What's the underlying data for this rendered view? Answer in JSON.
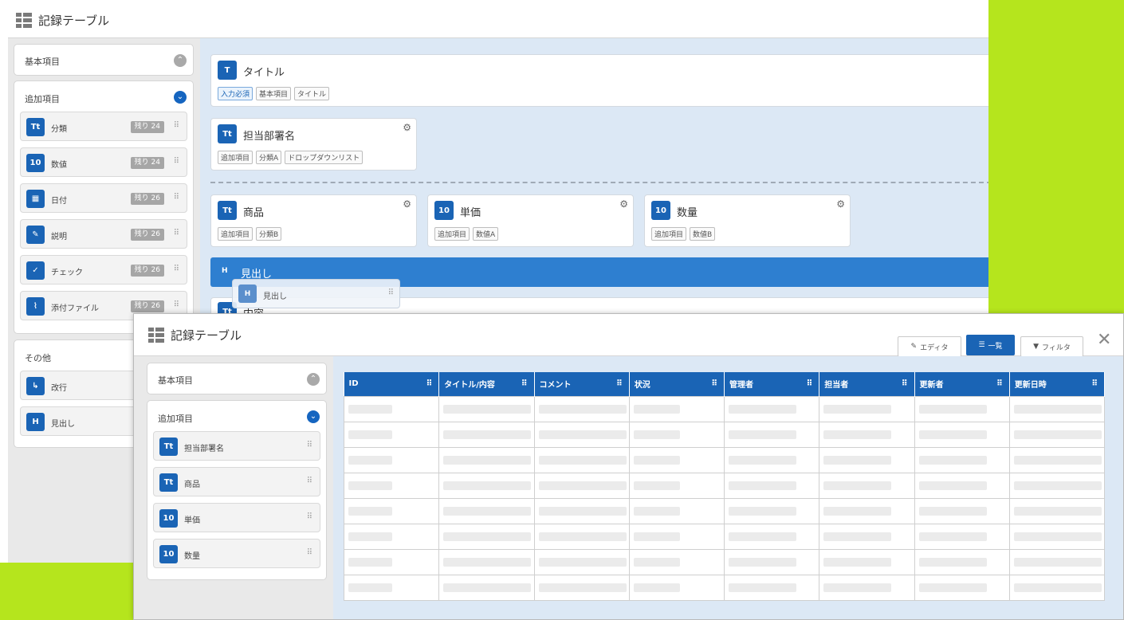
{
  "colors": {
    "accent": "#1a64b5",
    "heading_bar": "#2e7fd0",
    "canvas": "#dce8f5",
    "lime": "#b5e51d"
  },
  "editor": {
    "title": "記録テーブル",
    "basic_section": "基本項目",
    "additional_section": "追加項目",
    "other_section": "その他",
    "additional_items": [
      {
        "icon": "Tt",
        "icon_name": "text-field-icon",
        "label": "分類",
        "remain": "残り 24"
      },
      {
        "icon": "10",
        "icon_name": "number-field-icon",
        "label": "数値",
        "remain": "残り 24"
      },
      {
        "icon": "▦",
        "icon_name": "calendar-icon",
        "label": "日付",
        "remain": "残り 26"
      },
      {
        "icon": "✎",
        "icon_name": "description-icon",
        "label": "説明",
        "remain": "残り 26"
      },
      {
        "icon": "✓",
        "icon_name": "check-icon",
        "label": "チェック",
        "remain": "残り 26"
      },
      {
        "icon": "⌇",
        "icon_name": "attachment-icon",
        "label": "添付ファイル",
        "remain": "残り 26"
      }
    ],
    "other_items": [
      {
        "icon": "↳",
        "icon_name": "line-break-icon",
        "label": "改行"
      },
      {
        "icon": "H",
        "icon_name": "heading-icon",
        "label": "見出し"
      }
    ],
    "cards": {
      "title": {
        "icon": "T",
        "title": "タイトル",
        "tags": [
          "入力必須",
          "基本項目",
          "タイトル"
        ]
      },
      "dept": {
        "icon": "Tt",
        "title": "担当部署名",
        "tags": [
          "追加項目",
          "分類A",
          "ドロップダウンリスト"
        ]
      },
      "product": {
        "icon": "Tt",
        "title": "商品",
        "tags": [
          "追加項目",
          "分類B"
        ]
      },
      "price": {
        "icon": "10",
        "title": "単価",
        "tags": [
          "追加項目",
          "数値A"
        ]
      },
      "qty": {
        "icon": "10",
        "title": "数量",
        "tags": [
          "追加項目",
          "数値B"
        ]
      }
    },
    "heading_bar": {
      "icon": "H",
      "label": "見出し"
    },
    "ghost": {
      "icon": "H",
      "label": "見出し"
    },
    "partial_card_label": "内容"
  },
  "list": {
    "title": "記録テーブル",
    "toolbar": {
      "editor": "エディタ",
      "list": "一覧",
      "filter": "フィルタ"
    },
    "basic_section": "基本項目",
    "additional_section": "追加項目",
    "items": [
      {
        "icon": "Tt",
        "icon_name": "text-field-icon",
        "label": "担当部署名"
      },
      {
        "icon": "Tt",
        "icon_name": "text-field-icon",
        "label": "商品"
      },
      {
        "icon": "10",
        "icon_name": "number-field-icon",
        "label": "単価"
      },
      {
        "icon": "10",
        "icon_name": "number-field-icon",
        "label": "数量"
      }
    ],
    "columns": [
      "ID",
      "タイトル/内容",
      "コメント",
      "状況",
      "管理者",
      "担当者",
      "更新者",
      "更新日時"
    ],
    "row_count": 8
  }
}
